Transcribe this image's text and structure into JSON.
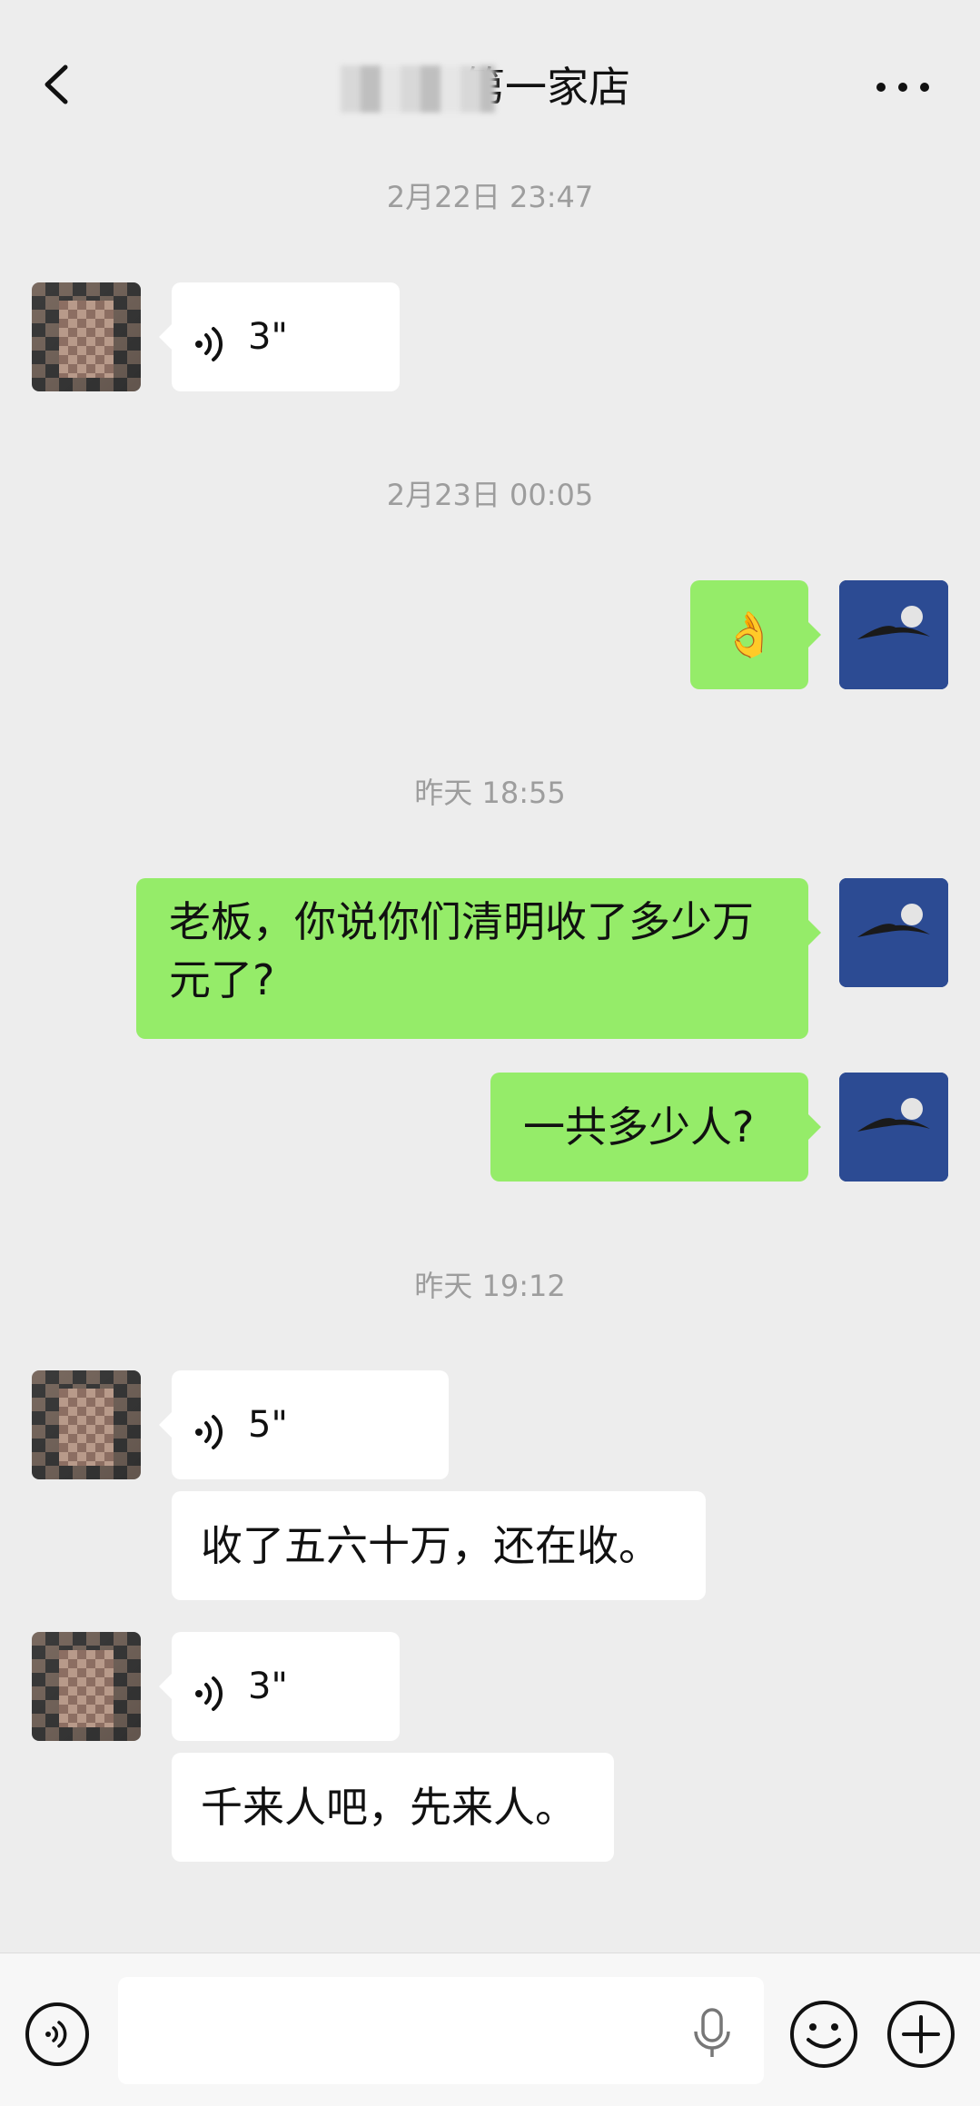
{
  "header": {
    "title": "第一家店"
  },
  "messages": {
    "t1": "2月22日 23:47",
    "m1_duration": "3\"",
    "t2": "2月23日 00:05",
    "m2_emoji": "👌",
    "t3": "昨天 18:55",
    "m3_text": "老板，你说你们清明收了多少万元了?",
    "m4_text": "一共多少人?",
    "t4": "昨天 19:12",
    "m5_duration": "5\"",
    "m6_text": "收了五六十万，还在收。",
    "m7_duration": "3\"",
    "m8_text": "千来人吧，先来人。"
  },
  "input": {
    "value": ""
  },
  "colors": {
    "background": "#ededed",
    "self_bubble": "#95ec69",
    "other_bubble": "#ffffff",
    "timestamp": "#9d9d9d"
  },
  "icons": [
    "back-arrow-icon",
    "more-icon",
    "voice-icon",
    "voice-toggle-icon",
    "mic-icon",
    "emoji-icon",
    "plus-icon"
  ]
}
